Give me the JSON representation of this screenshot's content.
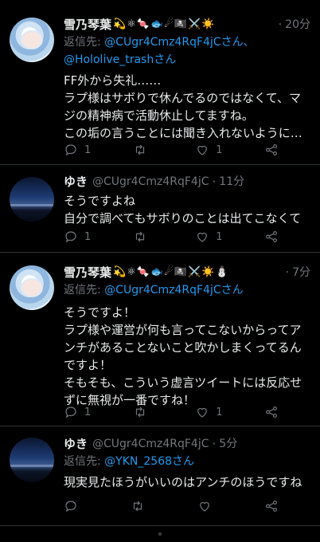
{
  "tweets": [
    {
      "name": "雪乃琴葉",
      "emojis": "💫⚛🍬🐟☄🏴‍☠️⚔️☀️",
      "time": "20分",
      "reply_prefix": "返信先: ",
      "reply_mentions": [
        "@CUgr4Cmz4RqF4jCさん、",
        "@Hololive_trashさん"
      ],
      "text": "FF外から失礼……\nラプ様はサボりで休んでるのではなくて、マジの精神病で活動休止してますね。\nこの垢の言うことには聞き入れないように…",
      "reply_count": "1",
      "retweet_count": "",
      "like_count": "1"
    },
    {
      "name": "ゆき",
      "handle": "@CUgr4Cmz4RqF4jC",
      "time": "11分",
      "text": "そうですよね\n自分で調べてもサボりのことは出てこなくて",
      "reply_count": "1",
      "retweet_count": "",
      "like_count": "1"
    },
    {
      "name": "雪乃琴葉",
      "emojis": "💫⚛🍬🐟☄🏴‍☠️⚔️☀️⛄",
      "time": "7分",
      "reply_prefix": "返信先: ",
      "reply_mentions": [
        "@CUgr4Cmz4RqF4jCさん"
      ],
      "text": "そうですよ！\nラプ様や運営が何も言ってこないからってアンチがあることないこと吹かしまくってるんですよ！\nそもそも、こういう虚言ツイートには反応せずに無視が一番ですね！",
      "reply_count": "1",
      "retweet_count": "",
      "like_count": "1"
    },
    {
      "name": "ゆき",
      "handle": "@CUgr4Cmz4RqF4jC",
      "time": "5分",
      "reply_prefix": "返信先: ",
      "reply_mentions": [
        "@YKN_2568さん"
      ],
      "text": "現実見たほうがいいのはアンチのほうですね",
      "reply_count": "",
      "retweet_count": "",
      "like_count": ""
    }
  ],
  "separator": "·",
  "colors": {
    "background": "#000000",
    "text": "#e7e9ea",
    "muted": "#71767b",
    "link": "#1d9bf0"
  },
  "icons": [
    "reply-icon",
    "retweet-icon",
    "like-icon",
    "share-icon"
  ]
}
